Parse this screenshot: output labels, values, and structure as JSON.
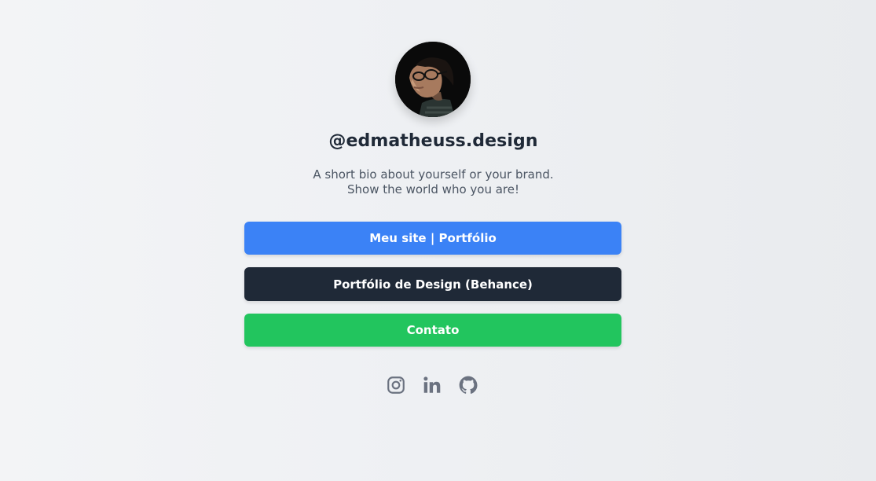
{
  "profile": {
    "handle": "@edmatheuss.design",
    "bio_line1": "A short bio about yourself or your brand.",
    "bio_line2": "Show the world who you are!"
  },
  "links": [
    {
      "label": "Meu site | Portfólio",
      "color": "#3b82f6"
    },
    {
      "label": "Portfólio de Design (Behance)",
      "color": "#1f2937"
    },
    {
      "label": "Contato",
      "color": "#22c55e"
    }
  ],
  "socials": [
    {
      "icon": "instagram-icon"
    },
    {
      "icon": "linkedin-icon"
    },
    {
      "icon": "github-icon"
    }
  ],
  "colors": {
    "icon": "#6b7280",
    "text_dark": "#1f2937",
    "text_muted": "#4b5563"
  }
}
